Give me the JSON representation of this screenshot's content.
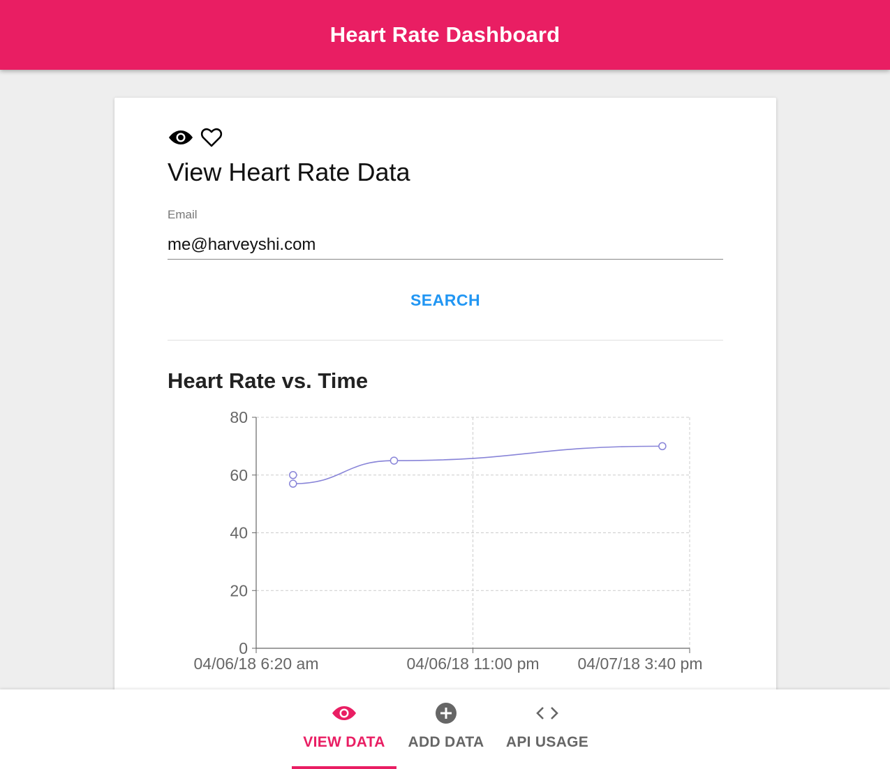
{
  "appbar": {
    "title": "Heart Rate Dashboard"
  },
  "colors": {
    "primary": "#e91e63",
    "accent": "#2196f3",
    "series": "#8884d8"
  },
  "card": {
    "icons": [
      "eye-icon",
      "heart-outline-icon"
    ],
    "title": "View Heart Rate Data",
    "email_label": "Email",
    "email_value": "me@harveyshi.com",
    "search_label": "SEARCH"
  },
  "chart_data": {
    "type": "line",
    "title": "Heart Rate vs. Time",
    "xlabel": "",
    "ylabel": "",
    "ylim": [
      0,
      80
    ],
    "yticks": [
      0,
      20,
      40,
      60,
      80
    ],
    "xticks": [
      "04/06/18 6:20 am",
      "04/06/18 11:00 pm",
      "04/07/18 3:40 pm"
    ],
    "grid": true,
    "series": [
      {
        "color": "#8884d8",
        "points": [
          {
            "x": 0.085,
            "y": 60
          },
          {
            "x": 0.085,
            "y": 57
          },
          {
            "x": 0.318,
            "y": 65
          },
          {
            "x": 0.937,
            "y": 70
          }
        ]
      }
    ]
  },
  "nav": {
    "items": [
      {
        "label": "VIEW DATA",
        "icon": "eye-icon",
        "active": true
      },
      {
        "label": "ADD DATA",
        "icon": "add-circle-icon",
        "active": false
      },
      {
        "label": "API USAGE",
        "icon": "code-icon",
        "active": false
      }
    ]
  }
}
